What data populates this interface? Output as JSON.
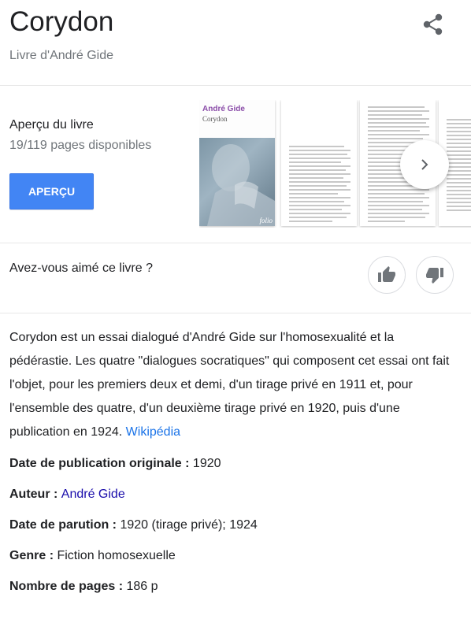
{
  "header": {
    "title": "Corydon",
    "subtitle": "Livre d'André Gide"
  },
  "icons": {
    "share": "share-icon",
    "next": "chevron-right-icon",
    "like": "thumb-up-icon",
    "dislike": "thumb-down-icon"
  },
  "preview": {
    "label": "Aperçu du livre",
    "pages": "19/119 pages disponibles",
    "button": "APERÇU",
    "cover_author": "André Gide",
    "cover_title": "Corydon",
    "cover_publisher": "folio"
  },
  "rating": {
    "question": "Avez-vous aimé ce livre ?"
  },
  "description": {
    "text": "Corydon est un essai dialogué d'André Gide sur l'homosexualité et la pédérastie. Les quatre \"dialogues socratiques\" qui composent cet essai ont fait l'objet, pour les premiers deux et demi, d'un tirage privé en 1911 et, pour l'ensemble des quatre, d'un deuxième tirage privé en 1920, puis d'une publication en 1924. ",
    "source": "Wikipédia"
  },
  "facts": {
    "orig_date_label": "Date de publication originale : ",
    "orig_date_value": "1920",
    "author_label": "Auteur : ",
    "author_value": "André Gide",
    "release_label": "Date de parution : ",
    "release_value": "1920 (tirage privé); 1924",
    "genre_label": "Genre : ",
    "genre_value": "Fiction homosexuelle",
    "pages_label": "Nombre de pages : ",
    "pages_value": "186 p"
  },
  "colors": {
    "accent": "#4285f4",
    "link": "#1a0dab",
    "muted": "#70757a"
  }
}
